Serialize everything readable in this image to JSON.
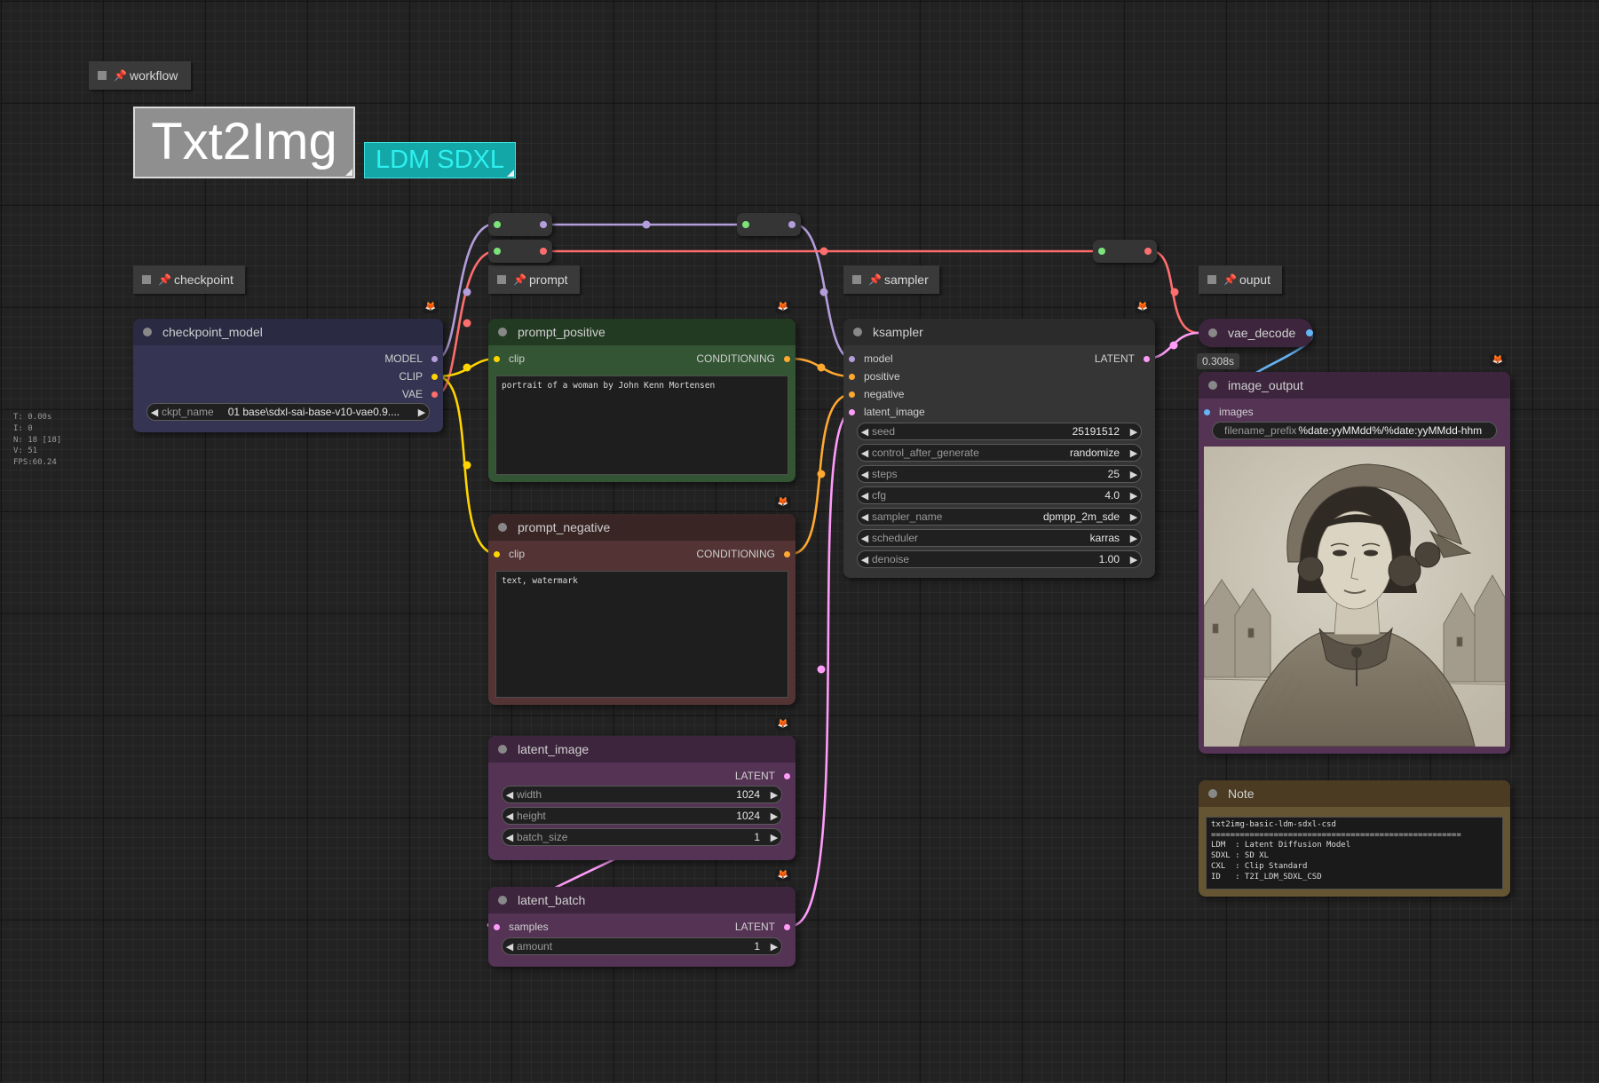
{
  "canvas_stats": [
    "T: 0.00s",
    "I: 0",
    "N: 18 [18]",
    "V: 51",
    "FPS:60.24"
  ],
  "titles": {
    "main": "Txt2Img",
    "sub": "LDM SDXL"
  },
  "groups": {
    "workflow": "workflow",
    "checkpoint": "checkpoint",
    "prompt": "prompt",
    "sampler": "sampler",
    "output": "ouput"
  },
  "nodes": {
    "checkpoint_model": {
      "title": "checkpoint_model",
      "outputs": [
        "MODEL",
        "CLIP",
        "VAE"
      ],
      "widgets": [
        {
          "label": "ckpt_name",
          "value": "01 base\\sdxl-sai-base-v10-vae0.9...."
        }
      ]
    },
    "prompt_positive": {
      "title": "prompt_positive",
      "input": "clip",
      "output": "CONDITIONING",
      "text": "portrait of a woman by John Kenn Mortensen"
    },
    "prompt_negative": {
      "title": "prompt_negative",
      "input": "clip",
      "output": "CONDITIONING",
      "text": "text, watermark"
    },
    "latent_image": {
      "title": "latent_image",
      "output": "LATENT",
      "widgets": [
        {
          "label": "width",
          "value": "1024"
        },
        {
          "label": "height",
          "value": "1024"
        },
        {
          "label": "batch_size",
          "value": "1"
        }
      ]
    },
    "latent_batch": {
      "title": "latent_batch",
      "input": "samples",
      "output": "LATENT",
      "widgets": [
        {
          "label": "amount",
          "value": "1"
        }
      ]
    },
    "ksampler": {
      "title": "ksampler",
      "inputs": [
        "model",
        "positive",
        "negative",
        "latent_image"
      ],
      "output": "LATENT",
      "widgets": [
        {
          "label": "seed",
          "value": "25191512"
        },
        {
          "label": "control_after_generate",
          "value": "randomize"
        },
        {
          "label": "steps",
          "value": "25"
        },
        {
          "label": "cfg",
          "value": "4.0"
        },
        {
          "label": "sampler_name",
          "value": "dpmpp_2m_sde"
        },
        {
          "label": "scheduler",
          "value": "karras"
        },
        {
          "label": "denoise",
          "value": "1.00"
        }
      ]
    },
    "vae_decode": {
      "title": "vae_decode",
      "time": "0.308s"
    },
    "image_output": {
      "title": "image_output",
      "input": "images",
      "widgets": [
        {
          "label": "filename_prefix",
          "value": "%date:yyMMdd%/%date:yyMMdd-hhm"
        }
      ]
    },
    "note": {
      "title": "Note",
      "text": "txt2img-basic-ldm-sdxl-csd\n====================================================\nLDM  : Latent Diffusion Model\nSDXL : SD XL\nCXL  : Clip Standard\nID   : T2I_LDM_SDXL_CSD"
    }
  },
  "colors": {
    "model_link": "#b39ddb",
    "clip_link": "#ffd500",
    "vae_link": "#ff6e6e",
    "conditioning_link": "#ffa931",
    "latent_link": "#ff9cf9",
    "image_link": "#64b5f6",
    "checkpoint_body": "#353553",
    "checkpoint_header": "#2a2a42",
    "positive_body": "#335533",
    "positive_header": "#223a22",
    "negative_body": "#533333",
    "negative_header": "#3a2525",
    "latent_body": "#553355",
    "latent_header": "#3d253d",
    "node_body": "#353535",
    "node_header": "#2b2b2b",
    "note_body": "#665533",
    "note_header": "#4a3b22"
  },
  "icons": [
    "pin-icon",
    "fox-badge-icon",
    "arrow-left-icon",
    "arrow-right-icon"
  ]
}
